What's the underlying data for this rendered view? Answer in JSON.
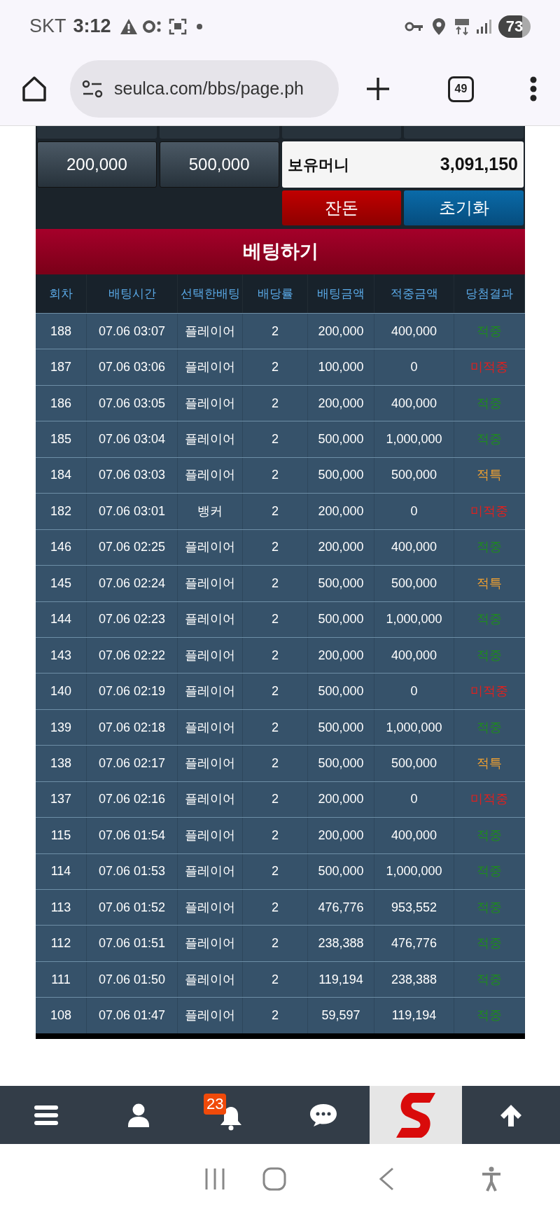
{
  "status_bar": {
    "carrier": "SKT",
    "time": "3:12",
    "battery": "73"
  },
  "browser": {
    "url": "seulca.com/bbs/page.ph",
    "tab_count": "49"
  },
  "amount_buttons": [
    "200,000",
    "500,000"
  ],
  "balance": {
    "label": "보유머니",
    "value": "3,091,150"
  },
  "action_buttons": [
    {
      "label": "잔돈",
      "kind": "change"
    },
    {
      "label": "초기화",
      "kind": "reset"
    }
  ],
  "bet_button": "베팅하기",
  "table": {
    "columns": [
      "회차",
      "배팅시간",
      "선택한배팅",
      "배당률",
      "배팅금액",
      "적중금액",
      "당첨결과"
    ],
    "rows": [
      {
        "round": "188",
        "time": "07.06 03:07",
        "pick": "플레이어",
        "odds": "2",
        "amount": "200,000",
        "payout": "400,000",
        "result": "적중",
        "color": "#1f8a1f"
      },
      {
        "round": "187",
        "time": "07.06 03:06",
        "pick": "플레이어",
        "odds": "2",
        "amount": "100,000",
        "payout": "0",
        "result": "미적중",
        "color": "#e0201e"
      },
      {
        "round": "186",
        "time": "07.06 03:05",
        "pick": "플레이어",
        "odds": "2",
        "amount": "200,000",
        "payout": "400,000",
        "result": "적중",
        "color": "#1f8a1f"
      },
      {
        "round": "185",
        "time": "07.06 03:04",
        "pick": "플레이어",
        "odds": "2",
        "amount": "500,000",
        "payout": "1,000,000",
        "result": "적중",
        "color": "#1f8a1f"
      },
      {
        "round": "184",
        "time": "07.06 03:03",
        "pick": "플레이어",
        "odds": "2",
        "amount": "500,000",
        "payout": "500,000",
        "result": "적특",
        "color": "#f0a030"
      },
      {
        "round": "182",
        "time": "07.06 03:01",
        "pick": "뱅커",
        "odds": "2",
        "amount": "200,000",
        "payout": "0",
        "result": "미적중",
        "color": "#e0201e"
      },
      {
        "round": "146",
        "time": "07.06 02:25",
        "pick": "플레이어",
        "odds": "2",
        "amount": "200,000",
        "payout": "400,000",
        "result": "적중",
        "color": "#1f8a1f"
      },
      {
        "round": "145",
        "time": "07.06 02:24",
        "pick": "플레이어",
        "odds": "2",
        "amount": "500,000",
        "payout": "500,000",
        "result": "적특",
        "color": "#f0a030"
      },
      {
        "round": "144",
        "time": "07.06 02:23",
        "pick": "플레이어",
        "odds": "2",
        "amount": "500,000",
        "payout": "1,000,000",
        "result": "적중",
        "color": "#1f8a1f"
      },
      {
        "round": "143",
        "time": "07.06 02:22",
        "pick": "플레이어",
        "odds": "2",
        "amount": "200,000",
        "payout": "400,000",
        "result": "적중",
        "color": "#1f8a1f"
      },
      {
        "round": "140",
        "time": "07.06 02:19",
        "pick": "플레이어",
        "odds": "2",
        "amount": "500,000",
        "payout": "0",
        "result": "미적중",
        "color": "#e0201e"
      },
      {
        "round": "139",
        "time": "07.06 02:18",
        "pick": "플레이어",
        "odds": "2",
        "amount": "500,000",
        "payout": "1,000,000",
        "result": "적중",
        "color": "#1f8a1f"
      },
      {
        "round": "138",
        "time": "07.06 02:17",
        "pick": "플레이어",
        "odds": "2",
        "amount": "500,000",
        "payout": "500,000",
        "result": "적특",
        "color": "#f0a030"
      },
      {
        "round": "137",
        "time": "07.06 02:16",
        "pick": "플레이어",
        "odds": "2",
        "amount": "200,000",
        "payout": "0",
        "result": "미적중",
        "color": "#e0201e"
      },
      {
        "round": "115",
        "time": "07.06 01:54",
        "pick": "플레이어",
        "odds": "2",
        "amount": "200,000",
        "payout": "400,000",
        "result": "적중",
        "color": "#1f8a1f"
      },
      {
        "round": "114",
        "time": "07.06 01:53",
        "pick": "플레이어",
        "odds": "2",
        "amount": "500,000",
        "payout": "1,000,000",
        "result": "적중",
        "color": "#1f8a1f"
      },
      {
        "round": "113",
        "time": "07.06 01:52",
        "pick": "플레이어",
        "odds": "2",
        "amount": "476,776",
        "payout": "953,552",
        "result": "적중",
        "color": "#1f8a1f"
      },
      {
        "round": "112",
        "time": "07.06 01:51",
        "pick": "플레이어",
        "odds": "2",
        "amount": "238,388",
        "payout": "476,776",
        "result": "적중",
        "color": "#1f8a1f"
      },
      {
        "round": "111",
        "time": "07.06 01:50",
        "pick": "플레이어",
        "odds": "2",
        "amount": "119,194",
        "payout": "238,388",
        "result": "적중",
        "color": "#1f8a1f"
      },
      {
        "round": "108",
        "time": "07.06 01:47",
        "pick": "플레이어",
        "odds": "2",
        "amount": "59,597",
        "payout": "119,194",
        "result": "적중",
        "color": "#1f8a1f"
      }
    ]
  },
  "bottom_nav": {
    "notification_count": "23"
  }
}
